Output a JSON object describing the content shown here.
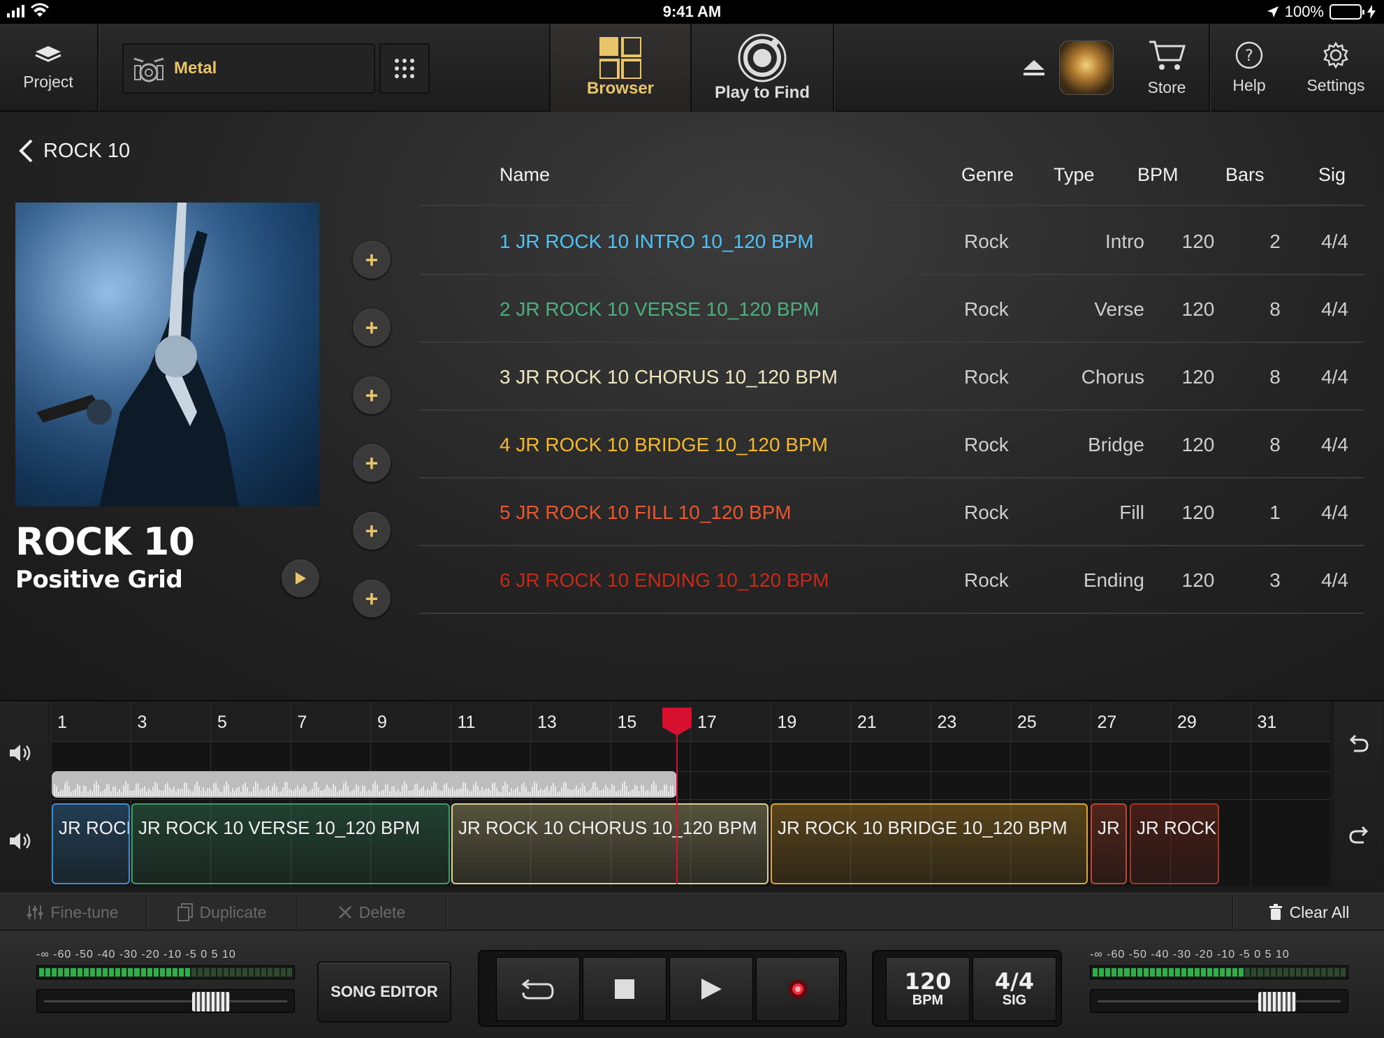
{
  "status": {
    "time": "9:41 AM",
    "battery": "100%"
  },
  "toolbar": {
    "project": "Project",
    "preset_name": "Metal",
    "tabs": [
      "Browser",
      "Play to Find"
    ],
    "store": "Store",
    "help": "Help",
    "settings": "Settings"
  },
  "browser": {
    "back_label": "ROCK 10",
    "album_title": "ROCK 10",
    "album_artist": "Positive Grid",
    "columns": {
      "name": "Name",
      "genre": "Genre",
      "type": "Type",
      "bpm": "BPM",
      "bars": "Bars",
      "sig": "Sig"
    },
    "rows": [
      {
        "name": "1 JR ROCK 10 INTRO 10_120 BPM",
        "genre": "Rock",
        "type": "Intro",
        "bpm": "120",
        "bars": "2",
        "sig": "4/4",
        "color": "#4fc3f7"
      },
      {
        "name": "2 JR ROCK 10 VERSE 10_120 BPM",
        "genre": "Rock",
        "type": "Verse",
        "bpm": "120",
        "bars": "8",
        "sig": "4/4",
        "color": "#4caf7d"
      },
      {
        "name": "3 JR ROCK 10 CHORUS 10_120 BPM",
        "genre": "Rock",
        "type": "Chorus",
        "bpm": "120",
        "bars": "8",
        "sig": "4/4",
        "color": "#f0e8c0"
      },
      {
        "name": "4 JR ROCK 10 BRIDGE 10_120 BPM",
        "genre": "Rock",
        "type": "Bridge",
        "bpm": "120",
        "bars": "8",
        "sig": "4/4",
        "color": "#f2b830"
      },
      {
        "name": "5 JR ROCK 10 FILL 10_120 BPM",
        "genre": "Rock",
        "type": "Fill",
        "bpm": "120",
        "bars": "1",
        "sig": "4/4",
        "color": "#e8572e"
      },
      {
        "name": "6 JR ROCK 10 ENDING 10_120 BPM",
        "genre": "Rock",
        "type": "Ending",
        "bpm": "120",
        "bars": "3",
        "sig": "4/4",
        "color": "#c42a1a"
      }
    ]
  },
  "timeline": {
    "bar_numbers": [
      "1",
      "3",
      "5",
      "7",
      "9",
      "11",
      "13",
      "15",
      "17",
      "19",
      "21",
      "23",
      "25",
      "27",
      "29",
      "31"
    ],
    "clips": [
      {
        "label": "JR ROCK",
        "color": "#3f8fd0"
      },
      {
        "label": "JR ROCK 10 VERSE 10_120 BPM",
        "color": "#3d9a6a"
      },
      {
        "label": "JR ROCK 10 CHORUS 10_120 BPM",
        "color": "#d9cf8e"
      },
      {
        "label": "JR ROCK 10 BRIDGE 10_120 BPM",
        "color": "#e0a52a"
      },
      {
        "label": "JR R",
        "color": "#c4462a"
      },
      {
        "label": "JR ROCK",
        "color": "#a9331f"
      }
    ]
  },
  "editbar": {
    "finetune": "Fine-tune",
    "duplicate": "Duplicate",
    "delete": "Delete",
    "clear_all": "Clear All"
  },
  "transport": {
    "meter_scale": "-∞  -60  -50  -40  -30  -20  -10   -5    0    5   10",
    "song_editor": "SONG EDITOR",
    "bpm_value": "120",
    "bpm_label": "BPM",
    "sig_value": "4/4",
    "sig_label": "SIG"
  }
}
